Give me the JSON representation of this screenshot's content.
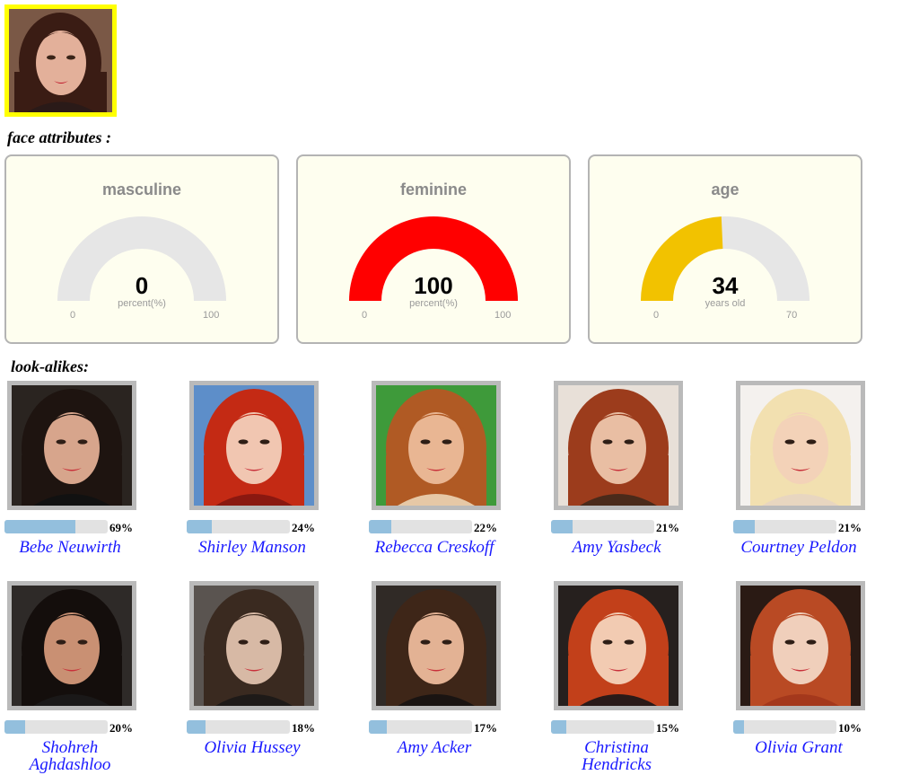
{
  "upload": {
    "label": ""
  },
  "sections": {
    "attributes": "face attributes :",
    "lookalikes": "look-alikes:"
  },
  "gauges": [
    {
      "title": "masculine",
      "value": "0",
      "unit": "percent(%)",
      "min": "0",
      "max": "100",
      "fraction": 0.0,
      "color": "#ff0000"
    },
    {
      "title": "feminine",
      "value": "100",
      "unit": "percent(%)",
      "min": "0",
      "max": "100",
      "fraction": 1.0,
      "color": "#ff0000"
    },
    {
      "title": "age",
      "value": "34",
      "unit": "years old",
      "min": "0",
      "max": "70",
      "fraction": 0.4857,
      "color": "#f2c200"
    }
  ],
  "lookalikes": [
    {
      "name": "Bebe Neuwirth",
      "percent": "69%",
      "fraction": 0.69,
      "hair": "#1e1410",
      "skin": "#d7a58c",
      "bg": "#2a2420",
      "top": "#111111"
    },
    {
      "name": "Shirley Manson",
      "percent": "24%",
      "fraction": 0.24,
      "hair": "#c42a14",
      "skin": "#f1c6b1",
      "bg": "#5d8ec9",
      "top": "#8a1810"
    },
    {
      "name": "Rebecca Creskoff",
      "percent": "22%",
      "fraction": 0.22,
      "hair": "#b05a24",
      "skin": "#e9b693",
      "bg": "#3e9a3a",
      "top": "#e6c8a6"
    },
    {
      "name": "Amy Yasbeck",
      "percent": "21%",
      "fraction": 0.21,
      "hair": "#9c3c1c",
      "skin": "#e9bea3",
      "bg": "#e8e0d8",
      "top": "#4a2a1a"
    },
    {
      "name": "Courtney Peldon",
      "percent": "21%",
      "fraction": 0.21,
      "hair": "#f2e0b0",
      "skin": "#f3d2b8",
      "bg": "#f4f1ee",
      "top": "#e8d6c0"
    },
    {
      "name": "Shohreh Aghdashloo",
      "percent": "20%",
      "fraction": 0.2,
      "hair": "#140e0c",
      "skin": "#c99073",
      "bg": "#2e2a28",
      "top": "#1a1818"
    },
    {
      "name": "Olivia Hussey",
      "percent": "18%",
      "fraction": 0.18,
      "hair": "#3a2a20",
      "skin": "#d7b9a5",
      "bg": "#5a5450",
      "top": "#1e1a18"
    },
    {
      "name": "Amy Acker",
      "percent": "17%",
      "fraction": 0.17,
      "hair": "#3e2618",
      "skin": "#e3b294",
      "bg": "#302a26",
      "top": "#1a1412"
    },
    {
      "name": "Christina Hendricks",
      "percent": "15%",
      "fraction": 0.15,
      "hair": "#c2401a",
      "skin": "#f2cbb2",
      "bg": "#26201e",
      "top": "#2a1a18"
    },
    {
      "name": "Olivia Grant",
      "percent": "10%",
      "fraction": 0.1,
      "hair": "#b94a24",
      "skin": "#f0cfbb",
      "bg": "#2a1a14",
      "top": "#a4381c"
    }
  ]
}
